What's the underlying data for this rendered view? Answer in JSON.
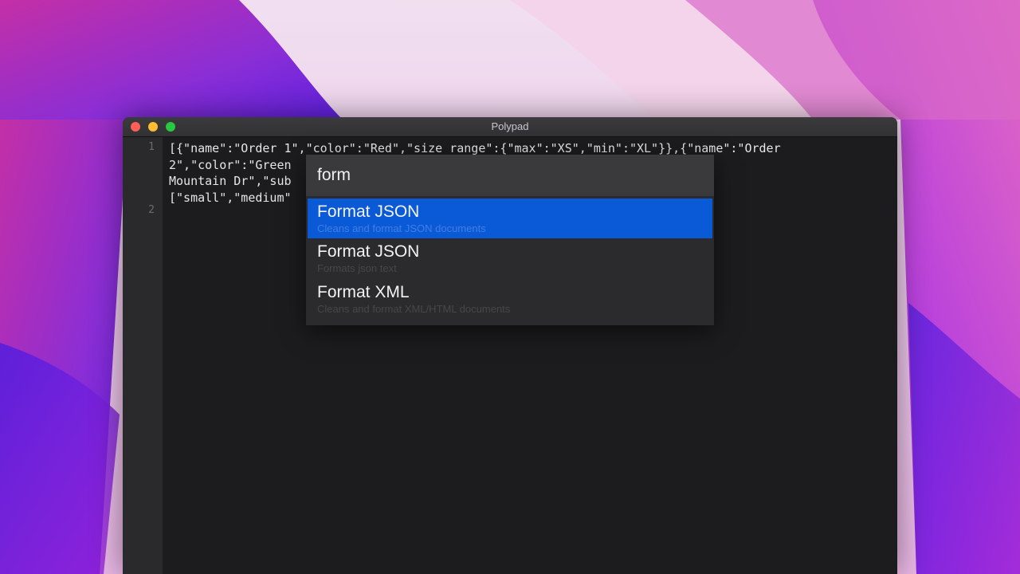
{
  "window": {
    "title": "Polypad"
  },
  "editor": {
    "line_numbers": [
      "1",
      "2"
    ],
    "lines": [
      "[{\"name\":\"Order 1\",\"color\":\"Red\",\"size_range\":{\"max\":\"XS\",\"min\":\"XL\"}},{\"name\":\"Order",
      "2\",\"color\":\"Green                             dress\":{\"line1\":\"312",
      "Mountain Dr\",\"sub                                        lue\",\"sizes\":",
      "[\"small\",\"medium\""
    ]
  },
  "command_palette": {
    "query": "form",
    "results": [
      {
        "title": "Format JSON",
        "description": "Cleans and format JSON documents"
      },
      {
        "title": "Format JSON",
        "description": "Formats json text"
      },
      {
        "title": "Format XML",
        "description": "Cleans and format XML/HTML documents"
      }
    ]
  },
  "colors": {
    "selection": "#0a5ad8",
    "window_background": "#1c1c1e",
    "close": "#ff5f57",
    "minimize": "#febc2e",
    "maximize": "#28c840"
  }
}
